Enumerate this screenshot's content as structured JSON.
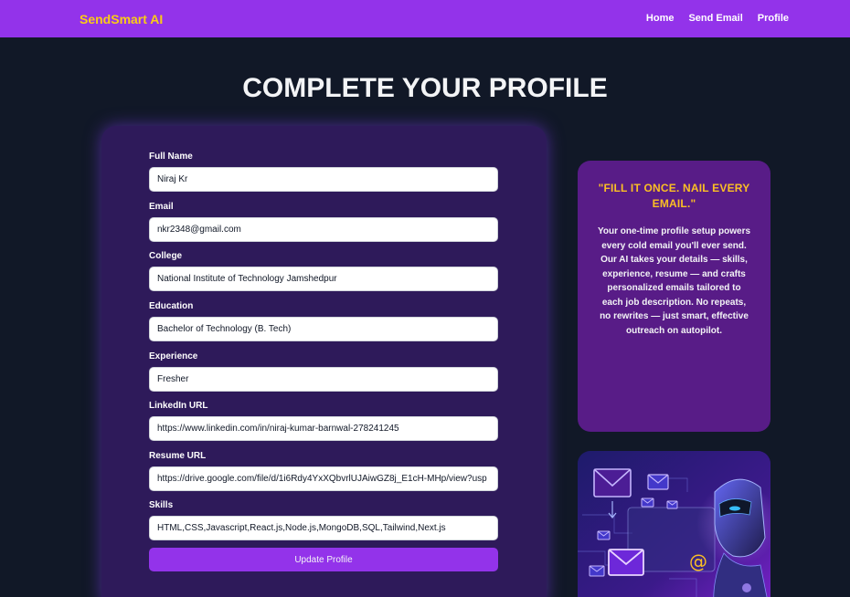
{
  "navbar": {
    "brand": "SendSmart AI",
    "links": [
      "Home",
      "Send Email",
      "Profile"
    ]
  },
  "page": {
    "title": "COMPLETE YOUR PROFILE"
  },
  "form": {
    "fields": [
      {
        "label": "Full Name",
        "value": "Niraj Kr"
      },
      {
        "label": "Email",
        "value": "nkr2348@gmail.com"
      },
      {
        "label": "College",
        "value": "National Institute of Technology Jamshedpur"
      },
      {
        "label": "Education",
        "value": "Bachelor of Technology (B. Tech)"
      },
      {
        "label": "Experience",
        "value": "Fresher"
      },
      {
        "label": "LinkedIn URL",
        "value": "https://www.linkedin.com/in/niraj-kumar-barnwal-278241245"
      },
      {
        "label": "Resume URL",
        "value": "https://drive.google.com/file/d/1i6Rdy4YxXQbvrlUJAiwGZ8j_E1cH-MHp/view?usp"
      },
      {
        "label": "Skills",
        "value": "HTML,CSS,Javascript,React.js,Node.js,MongoDB,SQL,Tailwind,Next.js"
      }
    ],
    "submit_label": "Update Profile"
  },
  "quote_card": {
    "title": "\"FILL IT ONCE. NAIL EVERY EMAIL.\"",
    "text": "Your one-time profile setup powers every cold email you'll ever send. Our AI takes your details — skills, experience, resume — and crafts personalized emails tailored to each job description. No repeats, no rewrites — just smart, effective outreach on autopilot."
  },
  "illustration": {
    "description_icon": "ai-robot-email-illustration",
    "symbol": "@"
  },
  "colors": {
    "navbar": "#9333ea",
    "brand": "#facc15",
    "background": "#111827",
    "form_card": "#2e1a5a",
    "quote_card": "#581c87",
    "quote_title": "#fbbf24",
    "button": "#9333ea"
  }
}
